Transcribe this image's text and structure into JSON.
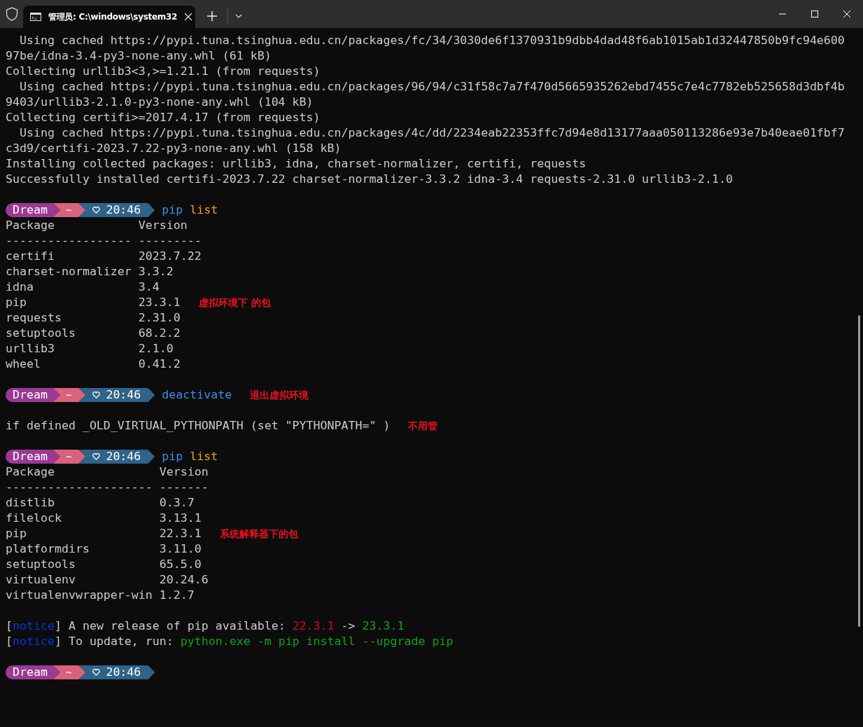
{
  "window": {
    "tab_title": "管理员: C:\\windows\\system32"
  },
  "lines": [
    {
      "kind": "text",
      "segments": [
        {
          "kind": "plain",
          "text": "  Using cached https://pypi.tuna.tsinghua.edu.cn/packages/fc/34/3030de6f1370931b9dbb4dad48f6ab1015ab1d32447850b9fc94e600"
        }
      ]
    },
    {
      "kind": "text",
      "segments": [
        {
          "kind": "plain",
          "text": "97be/idna-3.4-py3-none-any.whl (61 kB)"
        }
      ]
    },
    {
      "kind": "text",
      "segments": [
        {
          "kind": "plain",
          "text": "Collecting urllib3<3,>=1.21.1 (from requests)"
        }
      ]
    },
    {
      "kind": "text",
      "segments": [
        {
          "kind": "plain",
          "text": "  Using cached https://pypi.tuna.tsinghua.edu.cn/packages/96/94/c31f58c7a7f470d5665935262ebd7455c7e4c7782eb525658d3dbf4b"
        }
      ]
    },
    {
      "kind": "text",
      "segments": [
        {
          "kind": "plain",
          "text": "9403/urllib3-2.1.0-py3-none-any.whl (104 kB)"
        }
      ]
    },
    {
      "kind": "text",
      "segments": [
        {
          "kind": "plain",
          "text": "Collecting certifi>=2017.4.17 (from requests)"
        }
      ]
    },
    {
      "kind": "text",
      "segments": [
        {
          "kind": "plain",
          "text": "  Using cached https://pypi.tuna.tsinghua.edu.cn/packages/4c/dd/2234eab22353ffc7d94e8d13177aaa050113286e93e7b40eae01fbf7"
        }
      ]
    },
    {
      "kind": "text",
      "segments": [
        {
          "kind": "plain",
          "text": "c3d9/certifi-2023.7.22-py3-none-any.whl (158 kB)"
        }
      ]
    },
    {
      "kind": "text",
      "segments": [
        {
          "kind": "plain",
          "text": "Installing collected packages: urllib3, idna, charset-normalizer, certifi, requests"
        }
      ]
    },
    {
      "kind": "text",
      "segments": [
        {
          "kind": "plain",
          "text": "Successfully installed certifi-2023.7.22 charset-normalizer-3.3.2 idna-3.4 requests-2.31.0 urllib3-2.1.0"
        }
      ]
    },
    {
      "kind": "blank"
    },
    {
      "kind": "prompt",
      "user": "Dream",
      "dir": "~",
      "time": "20:46",
      "segments": [
        {
          "kind": "command",
          "text": "pip"
        },
        {
          "kind": "argument",
          "text": "list"
        }
      ]
    },
    {
      "kind": "text",
      "segments": [
        {
          "kind": "plain",
          "text": "Package            Version"
        }
      ]
    },
    {
      "kind": "text",
      "segments": [
        {
          "kind": "plain",
          "text": "------------------ ---------"
        }
      ]
    },
    {
      "kind": "text",
      "segments": [
        {
          "kind": "plain",
          "text": "certifi            2023.7.22"
        }
      ]
    },
    {
      "kind": "text",
      "segments": [
        {
          "kind": "plain",
          "text": "charset-normalizer 3.3.2"
        }
      ]
    },
    {
      "kind": "text",
      "segments": [
        {
          "kind": "plain",
          "text": "idna               3.4"
        }
      ]
    },
    {
      "kind": "text",
      "segments": [
        {
          "kind": "plain",
          "text": "pip                23.3.1"
        }
      ],
      "note": "虚拟环境下 的包"
    },
    {
      "kind": "text",
      "segments": [
        {
          "kind": "plain",
          "text": "requests           2.31.0"
        }
      ]
    },
    {
      "kind": "text",
      "segments": [
        {
          "kind": "plain",
          "text": "setuptools         68.2.2"
        }
      ]
    },
    {
      "kind": "text",
      "segments": [
        {
          "kind": "plain",
          "text": "urllib3            2.1.0"
        }
      ]
    },
    {
      "kind": "text",
      "segments": [
        {
          "kind": "plain",
          "text": "wheel              0.41.2"
        }
      ]
    },
    {
      "kind": "blank"
    },
    {
      "kind": "prompt",
      "user": "Dream",
      "dir": "~",
      "time": "20:46",
      "segments": [
        {
          "kind": "command",
          "text": "deactivate"
        }
      ],
      "note": "退出虚拟环境"
    },
    {
      "kind": "blank"
    },
    {
      "kind": "text",
      "segments": [
        {
          "kind": "plain",
          "text": "if defined _OLD_VIRTUAL_PYTHONPATH (set \"PYTHONPATH=\" )"
        }
      ],
      "note": "不用管"
    },
    {
      "kind": "blank"
    },
    {
      "kind": "prompt",
      "user": "Dream",
      "dir": "~",
      "time": "20:46",
      "segments": [
        {
          "kind": "command",
          "text": "pip"
        },
        {
          "kind": "argument",
          "text": "list"
        }
      ]
    },
    {
      "kind": "text",
      "segments": [
        {
          "kind": "plain",
          "text": "Package               Version"
        }
      ]
    },
    {
      "kind": "text",
      "segments": [
        {
          "kind": "plain",
          "text": "--------------------- -------"
        }
      ]
    },
    {
      "kind": "text",
      "segments": [
        {
          "kind": "plain",
          "text": "distlib               0.3.7"
        }
      ]
    },
    {
      "kind": "text",
      "segments": [
        {
          "kind": "plain",
          "text": "filelock              3.13.1"
        }
      ]
    },
    {
      "kind": "text",
      "segments": [
        {
          "kind": "plain",
          "text": "pip                   22.3.1"
        }
      ],
      "note": "系统解释器下的包"
    },
    {
      "kind": "text",
      "segments": [
        {
          "kind": "plain",
          "text": "platformdirs          3.11.0"
        }
      ]
    },
    {
      "kind": "text",
      "segments": [
        {
          "kind": "plain",
          "text": "setuptools            65.5.0"
        }
      ]
    },
    {
      "kind": "text",
      "segments": [
        {
          "kind": "plain",
          "text": "virtualenv            20.24.6"
        }
      ]
    },
    {
      "kind": "text",
      "segments": [
        {
          "kind": "plain",
          "text": "virtualenvwrapper-win 1.2.7"
        }
      ]
    },
    {
      "kind": "blank"
    },
    {
      "kind": "text",
      "segments": [
        {
          "kind": "plain",
          "text": "["
        },
        {
          "kind": "notice",
          "text": "notice"
        },
        {
          "kind": "plain",
          "text": "] A new release of pip available: "
        },
        {
          "kind": "old",
          "text": "22.3.1"
        },
        {
          "kind": "plain",
          "text": " -> "
        },
        {
          "kind": "new",
          "text": "23.3.1"
        }
      ]
    },
    {
      "kind": "text",
      "segments": [
        {
          "kind": "plain",
          "text": "["
        },
        {
          "kind": "notice",
          "text": "notice"
        },
        {
          "kind": "plain",
          "text": "] To update, run: "
        },
        {
          "kind": "new",
          "text": "python.exe -m pip install --upgrade pip"
        }
      ]
    },
    {
      "kind": "blank"
    },
    {
      "kind": "prompt",
      "user": "Dream",
      "dir": "~",
      "time": "20:46"
    }
  ]
}
